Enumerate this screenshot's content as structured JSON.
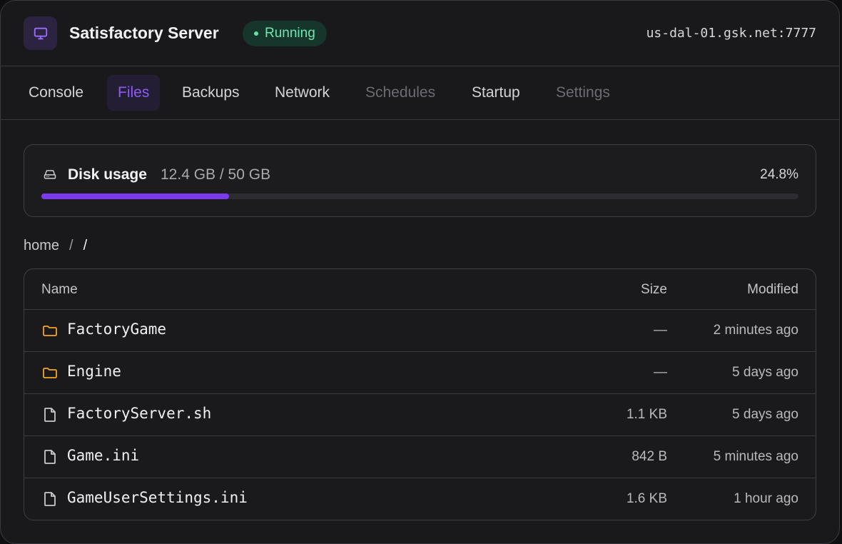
{
  "header": {
    "server_name": "Satisfactory Server",
    "status": "Running",
    "address": "us-dal-01.gsk.net:7777"
  },
  "tabs": [
    {
      "label": "Console",
      "state": "normal"
    },
    {
      "label": "Files",
      "state": "active"
    },
    {
      "label": "Backups",
      "state": "normal"
    },
    {
      "label": "Network",
      "state": "normal"
    },
    {
      "label": "Schedules",
      "state": "disabled"
    },
    {
      "label": "Startup",
      "state": "normal"
    },
    {
      "label": "Settings",
      "state": "disabled"
    }
  ],
  "disk": {
    "title": "Disk usage",
    "value": "12.4 GB / 50 GB",
    "percent_label": "24.8%",
    "fraction": 0.248
  },
  "breadcrumb": {
    "root": "home",
    "separator": "/",
    "current": "/"
  },
  "table": {
    "columns": {
      "name": "Name",
      "size": "Size",
      "modified": "Modified"
    },
    "rows": [
      {
        "type": "folder",
        "name": "FactoryGame",
        "size": "—",
        "modified": "2 minutes ago"
      },
      {
        "type": "folder",
        "name": "Engine",
        "size": "—",
        "modified": "5 days ago"
      },
      {
        "type": "file",
        "name": "FactoryServer.sh",
        "size": "1.1 KB",
        "modified": "5 days ago"
      },
      {
        "type": "file",
        "name": "Game.ini",
        "size": "842 B",
        "modified": "5 minutes ago"
      },
      {
        "type": "file",
        "name": "GameUserSettings.ini",
        "size": "1.6 KB",
        "modified": "1 hour ago"
      }
    ]
  },
  "colors": {
    "accent": "#7c3aed",
    "status_green": "#6fe6b0",
    "folder": "#f5a524"
  },
  "icons": {
    "server": "monitor-icon",
    "disk": "hard-drive-icon",
    "folder": "folder-icon",
    "file": "file-icon"
  }
}
